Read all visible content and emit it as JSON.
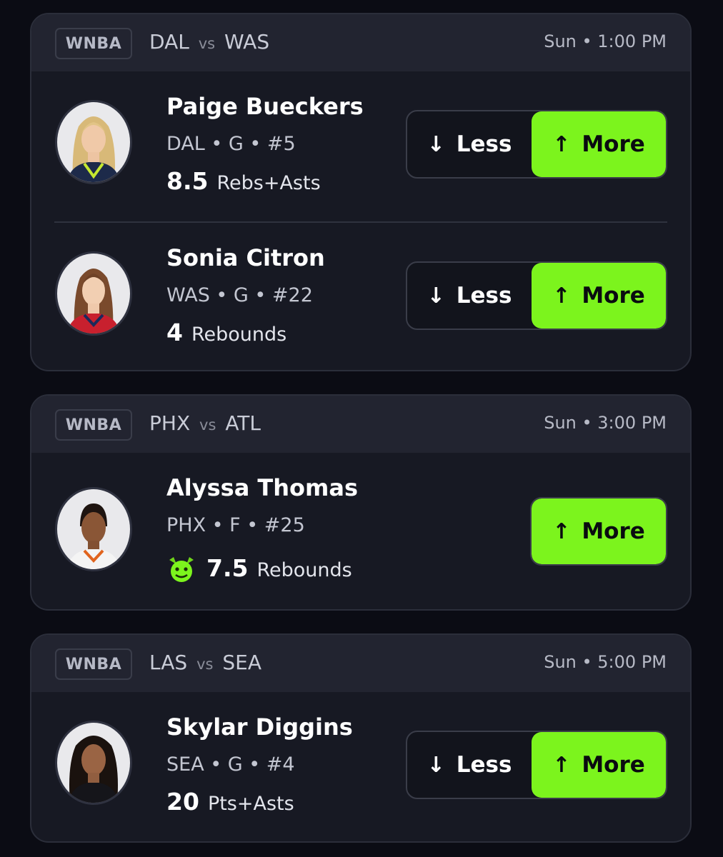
{
  "games": [
    {
      "league": "WNBA",
      "home": "DAL",
      "vs": "vs",
      "away": "WAS",
      "time": "Sun • 1:00 PM",
      "players": [
        {
          "name": "Paige Bueckers",
          "meta": "DAL • G • #5",
          "line": "8.5",
          "stat": "Rebs+Asts",
          "less": "Less",
          "more": "More"
        },
        {
          "name": "Sonia Citron",
          "meta": "WAS • G • #22",
          "line": "4",
          "stat": "Rebounds",
          "less": "Less",
          "more": "More"
        }
      ]
    },
    {
      "league": "WNBA",
      "home": "PHX",
      "vs": "vs",
      "away": "ATL",
      "time": "Sun • 3:00 PM",
      "players": [
        {
          "name": "Alyssa Thomas",
          "meta": "PHX • F • #25",
          "line": "7.5",
          "stat": "Rebounds",
          "more": "More"
        }
      ]
    },
    {
      "league": "WNBA",
      "home": "LAS",
      "vs": "vs",
      "away": "SEA",
      "time": "Sun • 5:00 PM",
      "players": [
        {
          "name": "Skylar Diggins",
          "meta": "SEA • G • #4",
          "line": "20",
          "stat": "Pts+Asts",
          "less": "Less",
          "more": "More"
        }
      ]
    }
  ],
  "icons": {
    "less": "arrow-down-icon",
    "more": "arrow-up-icon",
    "goblin": "goblin-icon"
  },
  "colors": {
    "accent": "#7cf41d",
    "background": "#0b0c14",
    "card": "#171923",
    "header": "#222430"
  }
}
